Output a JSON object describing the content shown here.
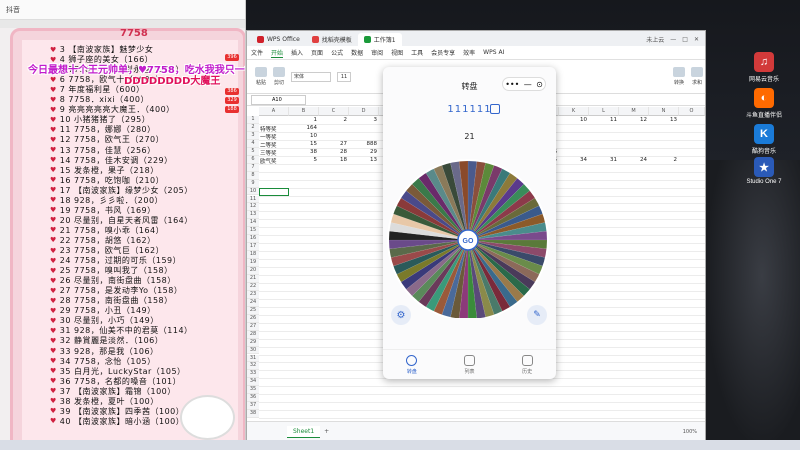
{
  "overlay": {
    "window_title": "抖音",
    "header_code": "7758",
    "banner_line1": "今日最想十个王元帅单，♥7758，吃水我我只一色♥",
    "banner_line2": "DDDDDDDD大魔王",
    "badges": [
      "396",
      "386",
      "329",
      "188"
    ],
    "list": [
      "3 【南波家族】魅梦少女",
      "4 狮子座的美女（166）",
      "5 7758，要和此别永恒（106）",
      "6 7758，欧气十（1000）",
      "7 年度福利星（600）",
      "8 7758．xixi（400）",
      "9 亮亮亮亮亮大魔王．（400）",
      "10 小猪猪猪了（295）",
      "11 7758，娜娜（280）",
      "12 7758，欧气王（270）",
      "13 7758，佳慧（256）",
      "14 7758，佳木安调（229）",
      "15 发条橙，果子（218）",
      "16 7758，吃饱咖（210）",
      "17 【南波家族】缘梦少女（205）",
      "18 928，彡彡啦．（200）",
      "19 7758，书风（169）",
      "20 尽量别，自星天者风雷（164）",
      "21 7758，嗅小乖（164）",
      "22 7758，胡悠（162）",
      "23 7758，欧气巨（162）",
      "24 7758，过期的可乐（159）",
      "25 7758，嗅叫我了（158）",
      "26 尽量别，南街盘曲（158）",
      "27 7758，是发动李Yo（158）",
      "28 7758，南街盘曲（158）",
      "29 7758，小丑（149）",
      "30 尽量别，小巧（149）",
      "31 928，仙美不中的君莫（114）",
      "32 静賞麗是淡然．（106）",
      "33 928，那是我（106）",
      "34 7758，念怡（105）",
      "35 白月光，LuckyStar（105）",
      "36 7758，名都的嗓音（101）",
      "37 【南波家族】霜锦（100）",
      "38 发条橙，夏叶（100）",
      "39 【南波家族】四季茜（100）",
      "40 【南波家族】暗小涵（100）"
    ]
  },
  "wps": {
    "tabs": [
      "WPS Office",
      "找稻壳模板",
      "工作簿1"
    ],
    "menu": [
      "文件",
      "开始",
      "插入",
      "页面",
      "公式",
      "数据",
      "审阅",
      "视图",
      "工具",
      "会员专享",
      "效率",
      "WPS AI"
    ],
    "menu_active": "开始",
    "ribbon": [
      "粘贴",
      "剪切",
      "格式刷",
      "转换",
      "条件格式",
      "求和",
      "数据处理"
    ],
    "font_name": "宋体",
    "font_size": "11",
    "cell_ref": "A10",
    "account": "未上云",
    "sheet_tab": "Sheet1",
    "zoom": "100%",
    "columns": [
      "A",
      "B",
      "C",
      "D",
      "E",
      "F",
      "G",
      "H",
      "I",
      "J",
      "K",
      "L",
      "M",
      "N",
      "O"
    ],
    "rows": [
      "1",
      "2",
      "3",
      "4",
      "5",
      "6",
      "7",
      "8",
      "9",
      "10",
      "11",
      "12",
      "13",
      "14",
      "15",
      "16",
      "17",
      "18",
      "19",
      "20",
      "21",
      "22",
      "23",
      "24",
      "25",
      "26",
      "27",
      "28",
      "29",
      "30",
      "31",
      "32",
      "33",
      "34",
      "35",
      "36",
      "37",
      "38"
    ],
    "cells": {
      "B1": "1",
      "C1": "2",
      "D1": "3",
      "K1": "10",
      "L1": "11",
      "M1": "12",
      "N1": "13",
      "A2": "特等奖",
      "B2": "164",
      "A3": "一等奖",
      "B3": "10",
      "A4": "二等奖",
      "B4": "15",
      "C4": "27",
      "D4": "888",
      "A5": "三等奖",
      "B5": "38",
      "C5": "28",
      "D5": "29",
      "J5": "6",
      "A6": "欧气奖",
      "B6": "5",
      "C6": "18",
      "D6": "13",
      "J6": "35",
      "K6": "34",
      "L6": "31",
      "M6": "24",
      "N6": "2"
    }
  },
  "turntable": {
    "title": "转盘",
    "name": "111111",
    "result": "21",
    "go_label": "GO",
    "nav": [
      "转盘",
      "列表",
      "历史"
    ],
    "segment_colors": [
      "#4a5a8c",
      "#8a4f3c",
      "#5c8a3a",
      "#7a3a6a",
      "#3a7a7a",
      "#8c7a3a",
      "#5a3a8c",
      "#3a8c5a",
      "#8c3a4a",
      "#6a6a3a",
      "#3a5a8c",
      "#8c5a2a",
      "#4a8c8c",
      "#7a4a8c",
      "#5a7a3a",
      "#8c4a6a",
      "#3a4a6a",
      "#6a8c4a",
      "#8c6a5a",
      "#4a3a5a",
      "#2a6a4a",
      "#9a7a4a",
      "#3a6a8c",
      "#7a2a3a",
      "#4a7a6a",
      "#8a8a4a",
      "#5a4a7a",
      "#3a8c3a",
      "#8c3a7a",
      "#6a5a3a",
      "#4a6a9a",
      "#9a5a3a",
      "#3a9a7a",
      "#6a3a5a",
      "#5a8a5a",
      "#8a6a8a",
      "#3a3a7a",
      "#7a7a2a",
      "#2a5a5a",
      "#9a4a4a",
      "#5a6a4a",
      "#6a4a8a",
      "#222222",
      "#dcdcdc",
      "#e8c8a8",
      "#3a5a3a",
      "#8a3a3a",
      "#4a4a8a",
      "#7a5a3a",
      "#3a7a4a",
      "#6a2a6a",
      "#5a8a8a",
      "#8a7a5a",
      "#3a4a3a",
      "#6a6a8a",
      "#8a4a2a"
    ]
  },
  "desktop": {
    "icons": [
      "网易云音乐",
      "斗鱼直播伴侣",
      "酷狗音乐",
      "Studio One 7"
    ]
  }
}
